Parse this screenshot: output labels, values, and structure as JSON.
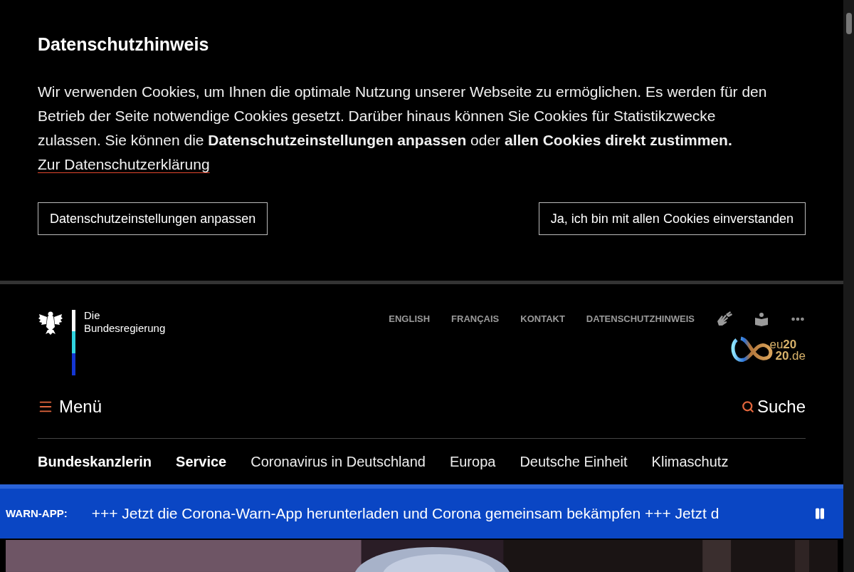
{
  "cookie_notice": {
    "title": "Datenschutzhinweis",
    "text": "Wir verwenden Cookies, um Ihnen die optimale Nutzung unserer Webseite zu ermöglichen. Es werden für den Betrieb der Seite notwendige Cookies gesetzt. Darüber hinaus können Sie Cookies für Statistikzwecke zulassen. Sie können die **Datenschutzeinstellungen anpassen** oder **allen Cookies direkt zustimmen.**",
    "link": "Zur Datenschutzerklärung",
    "buttons": [
      "Datenschutzeinstellungen anpassen",
      "Ja, ich bin mit allen Cookies einverstanden"
    ]
  },
  "header": {
    "logo_lines": [
      "Die",
      "Bundesregierung"
    ],
    "meta_links": [
      "ENGLISH",
      "FRANÇAIS",
      "KONTAKT",
      "DATENSCHUTZHINWEIS"
    ],
    "eu_logo_lines": [
      "eu**20**",
      "**20**.de"
    ],
    "menu_button": "Menü",
    "search_button": "Suche",
    "main_nav": [
      {
        "label": "Bundeskanzlerin",
        "emphasized": true
      },
      {
        "label": "Service",
        "emphasized": true
      },
      {
        "label": "Coronavirus in Deutschland",
        "emphasized": false
      },
      {
        "label": "Europa",
        "emphasized": false
      },
      {
        "label": "Deutsche Einheit",
        "emphasized": false
      },
      {
        "label": "Klimaschutz",
        "emphasized": false
      }
    ]
  },
  "ticker": {
    "label": "WARN-APP:",
    "text": "+++ Jetzt die Corona-Warn-App herunterladen und Corona gemeinsam bekämpfen +++ Jetzt d"
  }
}
